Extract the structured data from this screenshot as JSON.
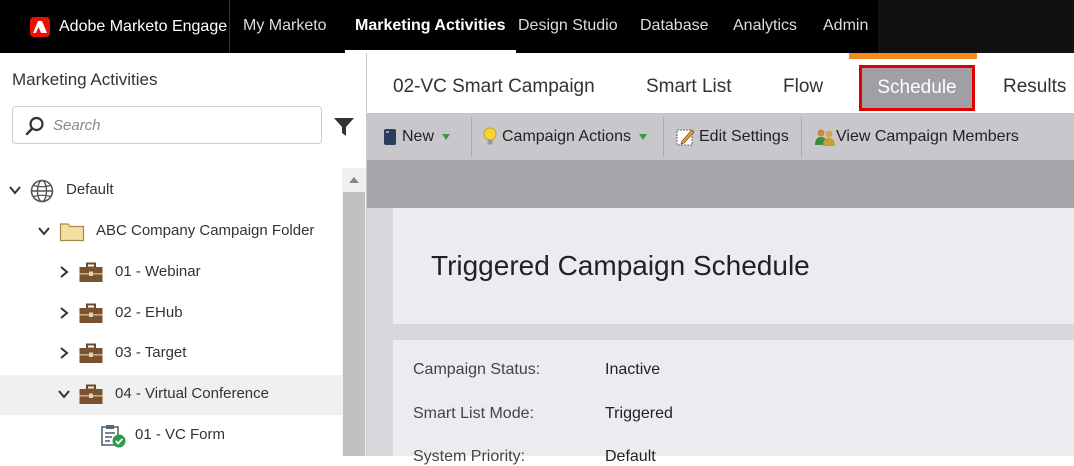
{
  "topnav": {
    "brand": "Adobe Marketo Engage",
    "items": [
      {
        "label": "My Marketo"
      },
      {
        "label": "Marketing Activities"
      },
      {
        "label": "Design Studio"
      },
      {
        "label": "Database"
      },
      {
        "label": "Analytics"
      },
      {
        "label": "Admin"
      }
    ]
  },
  "sidebar": {
    "title": "Marketing Activities",
    "search_placeholder": "Search",
    "tree": [
      {
        "label": "Default",
        "icon": "globe-icon",
        "expanded": true
      },
      {
        "label": "ABC Company Campaign Folder",
        "icon": "folder-icon",
        "expanded": true
      },
      {
        "label": "01 - Webinar",
        "icon": "briefcase-icon",
        "expanded": false
      },
      {
        "label": "02 - EHub",
        "icon": "briefcase-icon",
        "expanded": false
      },
      {
        "label": "03 - Target",
        "icon": "briefcase-icon",
        "expanded": false
      },
      {
        "label": "04 - Virtual Conference",
        "icon": "briefcase-icon",
        "expanded": true
      },
      {
        "label": "01 - VC Form",
        "icon": "smart-campaign-icon"
      }
    ]
  },
  "tabs": {
    "campaign": "02-VC Smart Campaign",
    "smart_list": "Smart List",
    "flow": "Flow",
    "schedule": "Schedule",
    "results": "Results"
  },
  "toolbar": {
    "new": "New",
    "campaign_actions": "Campaign Actions",
    "edit_settings": "Edit Settings",
    "view_members": "View Campaign Members"
  },
  "schedule": {
    "title": "Triggered Campaign Schedule",
    "fields": [
      {
        "label": "Campaign Status:",
        "value": "Inactive"
      },
      {
        "label": "Smart List Mode:",
        "value": "Triggered"
      },
      {
        "label": "System Priority:",
        "value": "Default"
      }
    ]
  },
  "colors": {
    "accent_orange": "#f38a1e",
    "highlight_red": "#e10000",
    "adobe_red": "#eb1000"
  }
}
